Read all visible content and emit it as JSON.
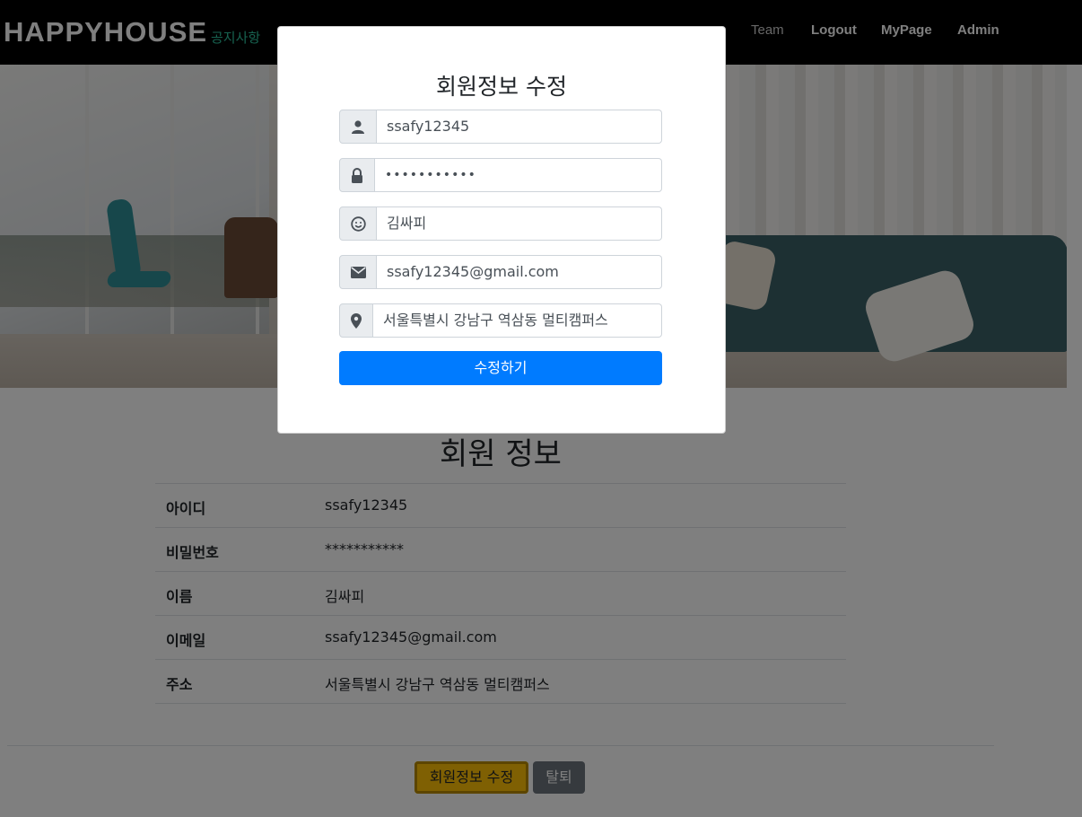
{
  "navbar": {
    "brand": "HAPPYHOUSE",
    "brand_sub": "공지사항",
    "links": [
      "Team",
      "Logout",
      "MyPage",
      "Admin"
    ]
  },
  "member_info": {
    "title": "회원 정보",
    "rows": [
      {
        "label": "아이디",
        "value": "ssafy12345"
      },
      {
        "label": "비밀번호",
        "value": "***********"
      },
      {
        "label": "이름",
        "value": "김싸피"
      },
      {
        "label": "이메일",
        "value": "ssafy12345@gmail.com"
      },
      {
        "label": "주소",
        "value": "서울특별시 강남구 역삼동 멀티캠퍼스"
      }
    ],
    "edit_button": "회원정보 수정",
    "withdraw_button": "탈퇴"
  },
  "modal": {
    "title": "회원정보 수정",
    "fields": {
      "id": {
        "value": "ssafy12345",
        "icon": "user-icon"
      },
      "password": {
        "value": "•••••••••••",
        "icon": "lock-icon"
      },
      "name": {
        "value": "김싸피",
        "icon": "smile-icon"
      },
      "email": {
        "value": "ssafy12345@gmail.com",
        "icon": "envelope-icon"
      },
      "address": {
        "value": "서울특별시 강남구 역삼동 멀티캠퍼스",
        "icon": "map-marker-icon"
      }
    },
    "submit_label": "수정하기"
  },
  "colors": {
    "primary": "#007bff",
    "warning": "#ffc107",
    "secondary": "#6c757d",
    "brand_accent": "#2ec4a0"
  }
}
